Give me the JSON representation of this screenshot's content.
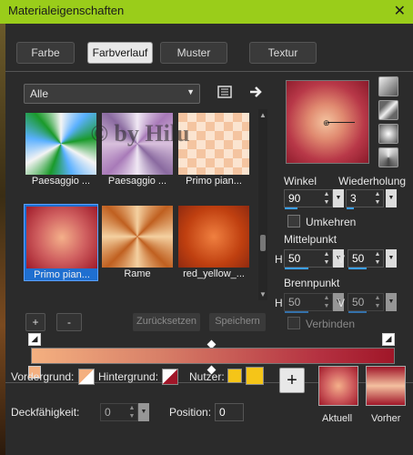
{
  "window": {
    "title": "Materialeigenschaften",
    "close": "✕"
  },
  "tabs": [
    {
      "label": "Farbe"
    },
    {
      "label": "Farbverlauf",
      "active": true
    },
    {
      "label": "Muster"
    },
    {
      "label": "Textur"
    }
  ],
  "category": {
    "value": "Alle"
  },
  "gallery": {
    "items": [
      {
        "caption": "Paesaggio ..."
      },
      {
        "caption": "Paesaggio ..."
      },
      {
        "caption": "Primo pian..."
      },
      {
        "caption": "Primo pian...",
        "selected": true
      },
      {
        "caption": "Rame"
      },
      {
        "caption": "red_yellow_..."
      }
    ],
    "watermark": "© by Hilu"
  },
  "buttons": {
    "add": "+",
    "remove": "-",
    "reset": "Zurücksetzen",
    "save": "Speichern"
  },
  "angle": {
    "label": "Winkel",
    "value": "90"
  },
  "repeat": {
    "label": "Wiederholung",
    "value": "3"
  },
  "invert": {
    "label": "Umkehren"
  },
  "center": {
    "label": "Mittelpunkt",
    "h_label": "H",
    "h_value": "50",
    "v_label": "V",
    "v_value": "50"
  },
  "focus": {
    "label": "Brennpunkt",
    "h_label": "H",
    "h_value": "50",
    "v_label": "V",
    "v_value": "50"
  },
  "link": {
    "label": "Verbinden"
  },
  "bottom": {
    "foreground": "Vordergrund:",
    "background": "Hintergrund:",
    "user": "Nutzer:",
    "opacity_label": "Deckfähigkeit:",
    "opacity_value": "0",
    "position_label": "Position:",
    "position_value": "0",
    "plus": "+",
    "current": "Aktuell",
    "previous": "Vorher"
  },
  "colors": {
    "accent": "#9acd1a",
    "selection": "#1f6fd0",
    "grad_start": "#f4b080",
    "grad_end": "#a01628",
    "user_swatch": "#f5c518"
  }
}
